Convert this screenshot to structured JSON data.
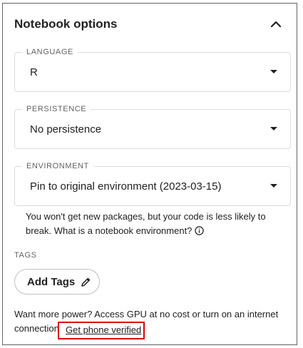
{
  "panel": {
    "title": "Notebook options"
  },
  "language": {
    "label": "LANGUAGE",
    "value": "R"
  },
  "persistence": {
    "label": "PERSISTENCE",
    "value": "No persistence"
  },
  "environment": {
    "label": "ENVIRONMENT",
    "value": "Pin to original environment (2023-03-15)",
    "helper": "You won't get new packages, but your code is less likely to break. What is a notebook environment?"
  },
  "tags": {
    "label": "TAGS",
    "add_button": "Add Tags"
  },
  "footer": {
    "text_line1": "Want more power? Access GPU at no cost or turn on an internet",
    "text_line2_prefix": "connection.",
    "verify_link": "Get phone verified"
  },
  "icons": {
    "collapse": "chevron-up-icon",
    "dropdown": "arrow-drop-down-icon",
    "info": "info-icon",
    "edit": "pencil-icon"
  },
  "colors": {
    "highlight_border": "#e00000",
    "panel_border": "#5f6368"
  }
}
